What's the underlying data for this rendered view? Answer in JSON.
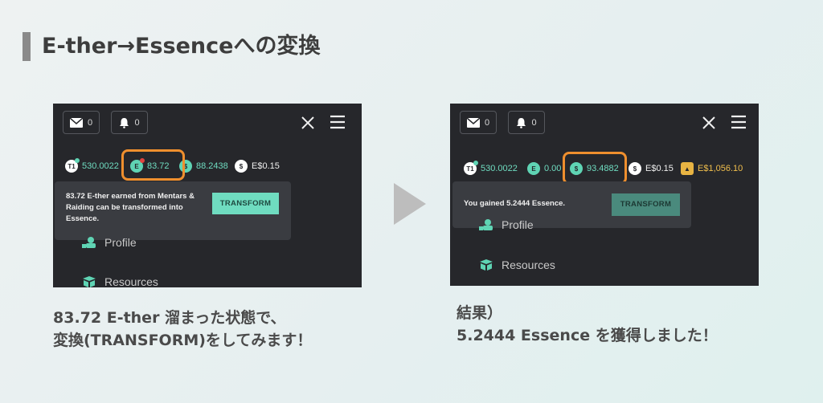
{
  "heading": "E-ther→Essenceへの変換",
  "before": {
    "mail_count": "0",
    "bell_count": "0",
    "balances": {
      "t1": "530.0022",
      "ether": "83.72",
      "essence": "88.2438",
      "ecash": "E$0.15"
    },
    "popup_text": "83.72 E-ther earned from Mentars & Raiding can be transformed into Essence.",
    "transform_label": "TRANSFORM",
    "menu": {
      "profile": "Profile",
      "resources": "Resources"
    }
  },
  "after": {
    "mail_count": "0",
    "bell_count": "0",
    "balances": {
      "t1": "530.0022",
      "ether": "0.00",
      "essence": "93.4882",
      "ecash": "E$0.15",
      "gold": "E$1,056.10"
    },
    "popup_text": "You gained 5.2444 Essence.",
    "transform_label": "TRANSFORM",
    "menu": {
      "profile": "Profile",
      "resources": "Resources"
    }
  },
  "caption_left": {
    "line1": "83.72 E-ther 溜まった状態で、",
    "line2": "変換(TRANSFORM)をしてみます！"
  },
  "caption_right": {
    "line1": "結果）",
    "line2": "5.2444 Essence を獲得しました！"
  },
  "colors": {
    "accent_teal": "#6fdcc0",
    "highlight_orange": "#ef8f2e",
    "panel_bg": "#26272b"
  }
}
